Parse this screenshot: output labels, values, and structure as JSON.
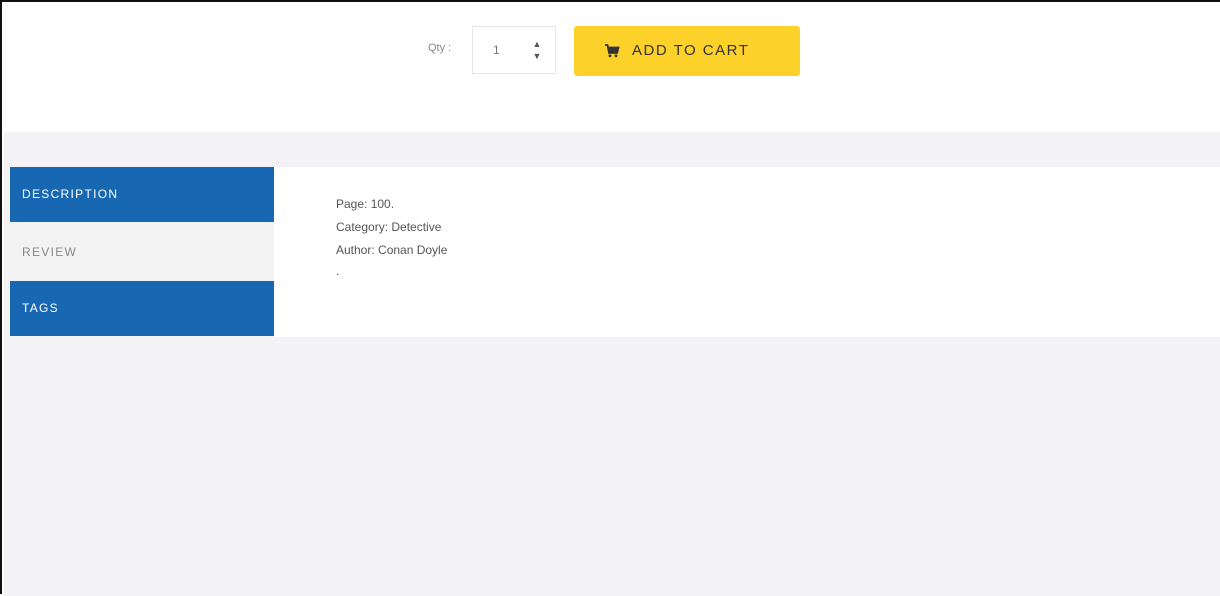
{
  "product_actions": {
    "qty_label": "Qty :",
    "qty_value": "1",
    "increment_icon": "caret-up-icon",
    "decrement_icon": "caret-down-icon",
    "add_to_cart_label": "ADD TO CART",
    "cart_icon": "shopping-cart-icon",
    "button_color": "#fcd12a"
  },
  "tabs": {
    "active_color": "#1867b2",
    "items": [
      {
        "label": "DESCRIPTION",
        "state": "active"
      },
      {
        "label": "REVIEW",
        "state": "inactive"
      },
      {
        "label": "TAGS",
        "state": "active"
      }
    ]
  },
  "description": {
    "lines": [
      "Page: 100.",
      "Category: Detective",
      "Author: Conan Doyle",
      "."
    ]
  }
}
